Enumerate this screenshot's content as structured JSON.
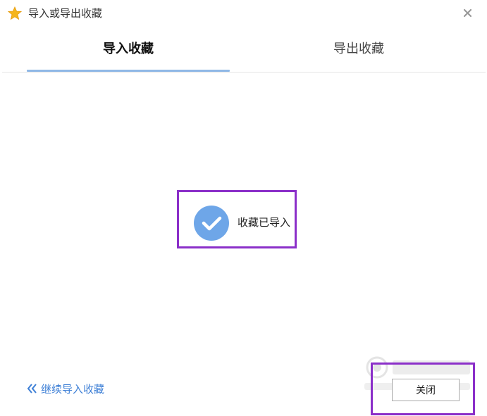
{
  "window": {
    "title": "导入或导出收藏",
    "icon": "star-icon",
    "close_icon": "close-icon"
  },
  "tabs": [
    {
      "label": "导入收藏",
      "active": true
    },
    {
      "label": "导出收藏",
      "active": false
    }
  ],
  "status": {
    "icon": "check-circle-icon",
    "message": "收藏已导入"
  },
  "footer": {
    "continue_icon": "double-chevron-left-icon",
    "continue_label": "继续导入收藏",
    "close_label": "关闭"
  },
  "colors": {
    "accent_blue": "#6ea6e8",
    "link_blue": "#3d7fd6",
    "tab_underline": "#8fb8e6",
    "highlight_purple": "#8b2fc9",
    "star_yellow": "#f5b51b"
  }
}
